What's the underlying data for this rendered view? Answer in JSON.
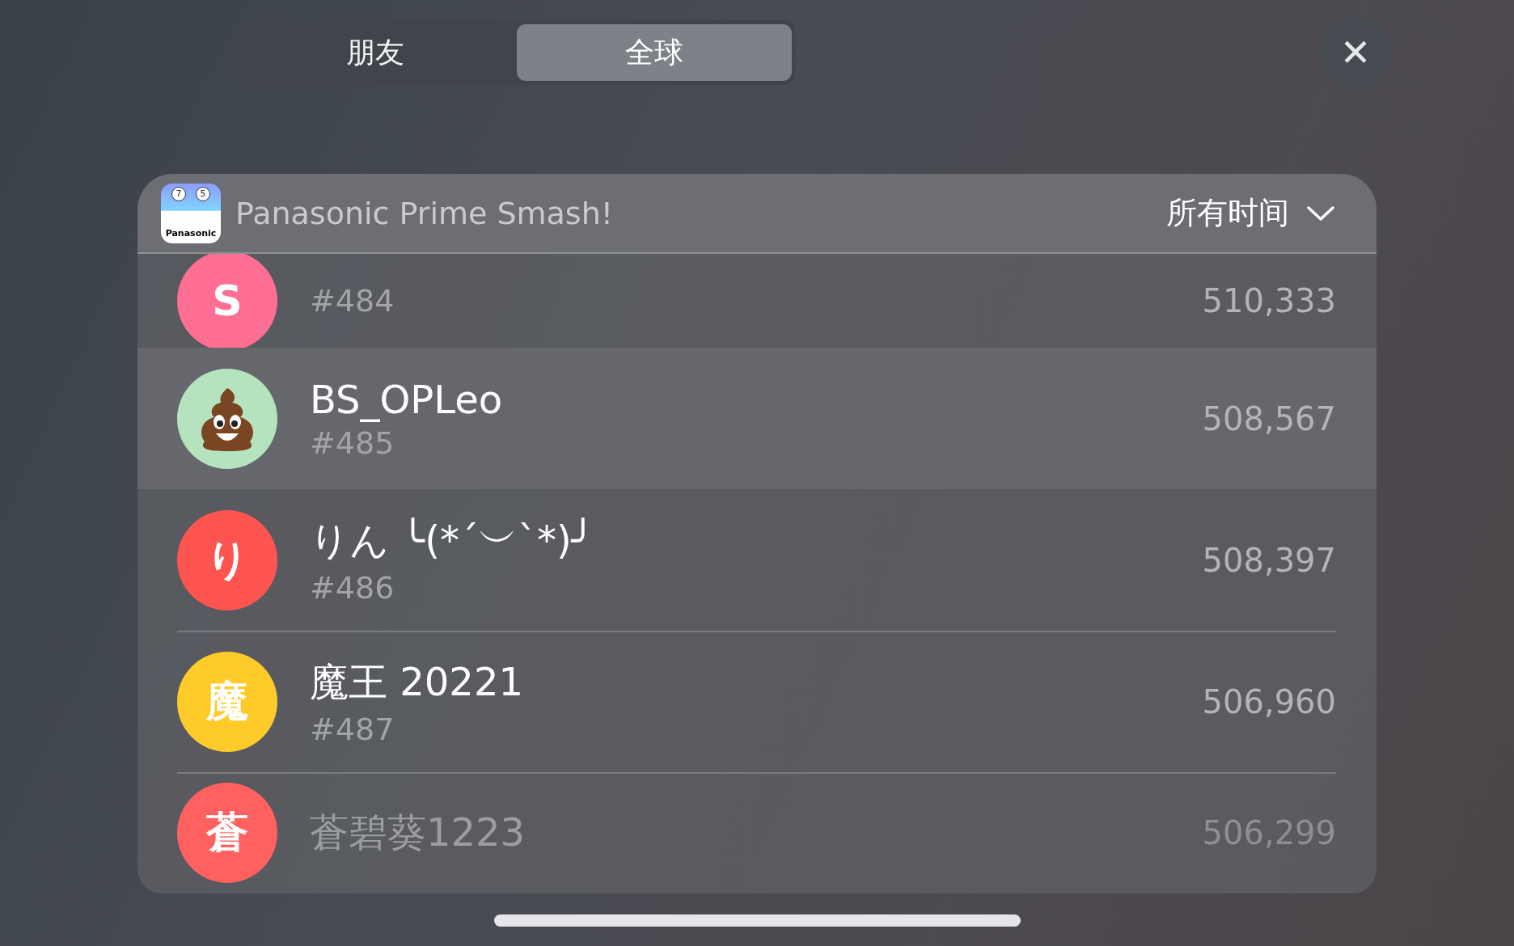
{
  "tabs": [
    {
      "label": "朋友",
      "selected": false
    },
    {
      "label": "全球",
      "selected": true
    }
  ],
  "close": {
    "symbol": "✕"
  },
  "leaderboard": {
    "game": "Panasonic Prime Smash!",
    "app_icon": {
      "digits": [
        "7",
        "5"
      ],
      "brand": "Panasonic"
    },
    "period": "所有时间",
    "rows": [
      {
        "rank": "#484",
        "score": "510,333",
        "avatar": {
          "kind": "letter",
          "letter": "S",
          "color": "#ff6f93"
        },
        "selected": false
      },
      {
        "name": "BS_OPLeo",
        "rank": "#485",
        "score": "508,567",
        "avatar": {
          "kind": "emoji",
          "color": "#b4e3bd"
        },
        "selected": true
      },
      {
        "name": "りん ╰(*´︶`*)╯",
        "rank": "#486",
        "score": "508,397",
        "avatar": {
          "kind": "letter",
          "letter": "り",
          "color": "#ff5551"
        },
        "selected": false
      },
      {
        "name": "魔王 20221",
        "rank": "#487",
        "score": "506,960",
        "avatar": {
          "kind": "letter",
          "letter": "魔",
          "color": "#ffcb2a"
        },
        "selected": false
      },
      {
        "name": "蒼碧葵1223",
        "score": "506,299",
        "avatar": {
          "kind": "letter",
          "letter": "蒼",
          "color": "#ff6060"
        },
        "selected": false
      }
    ]
  }
}
